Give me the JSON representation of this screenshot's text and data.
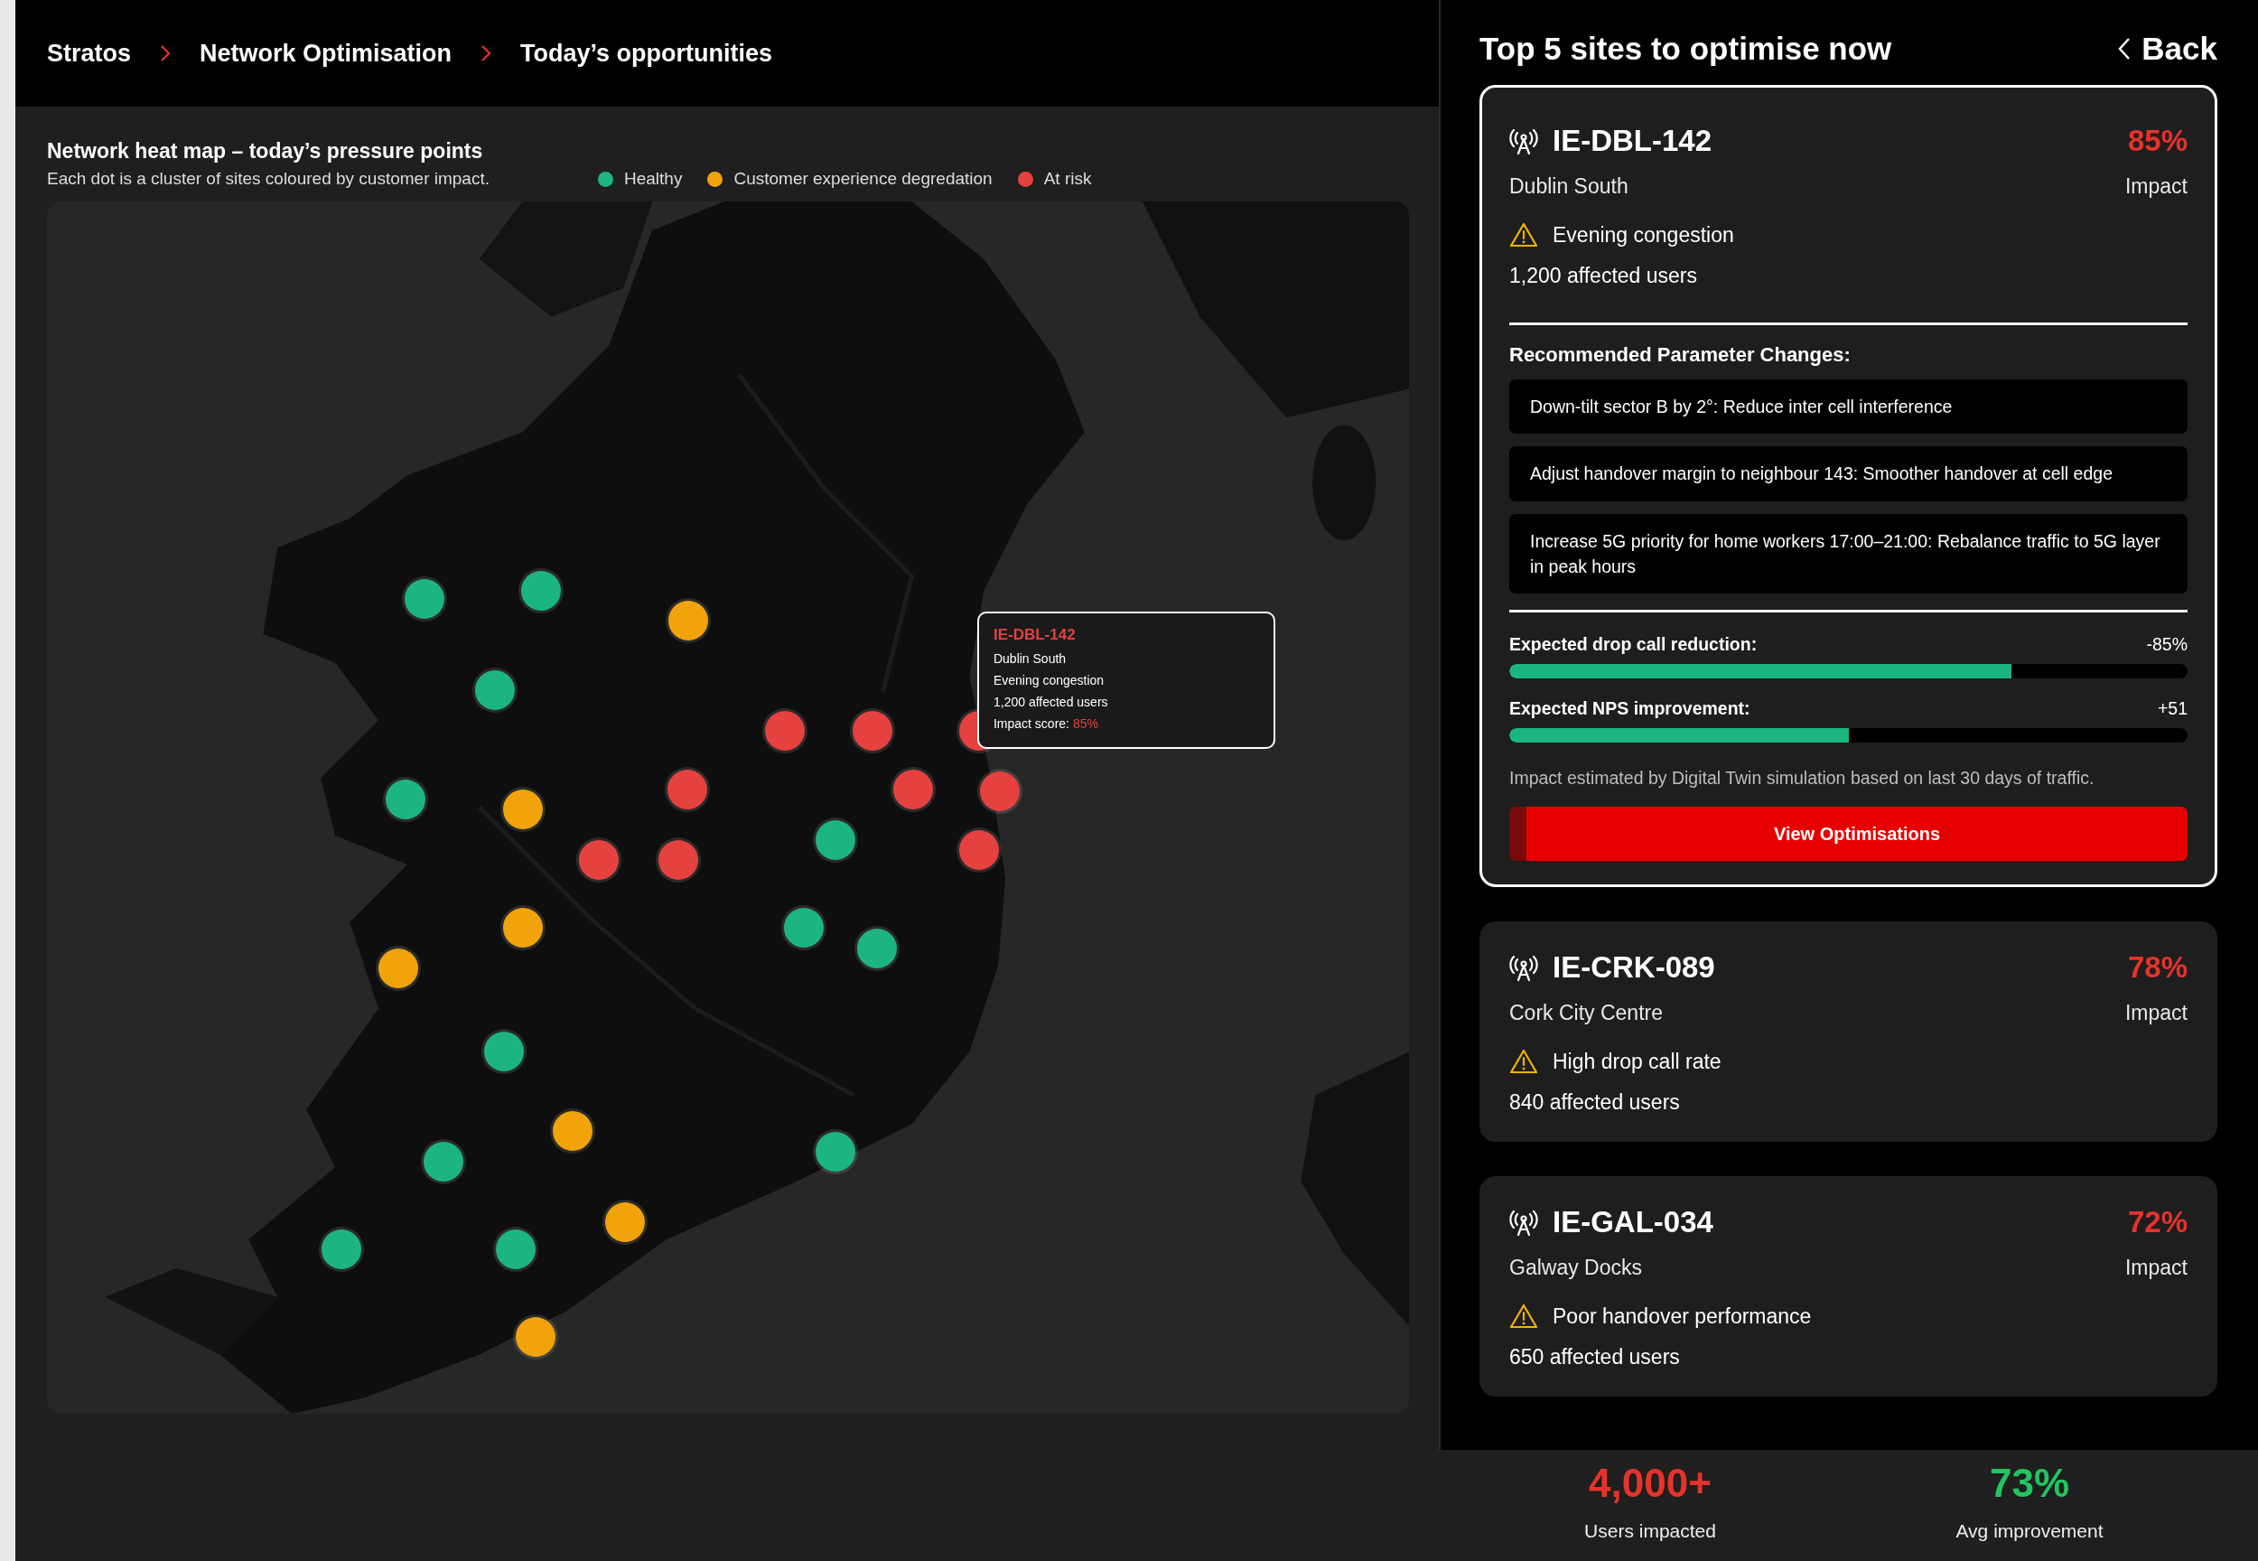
{
  "breadcrumb": [
    {
      "label": "Stratos"
    },
    {
      "label": "Network Optimisation"
    },
    {
      "label": "Today’s opportunities"
    }
  ],
  "heat_map": {
    "title": "Network heat map – today’s pressure points",
    "subtitle": "Each dot is a cluster of sites coloured by customer impact.",
    "legend": [
      {
        "label": "Healthy",
        "color": "#1db57f"
      },
      {
        "label": "Customer experience degredation",
        "color": "#f0a30a"
      },
      {
        "label": "At risk",
        "color": "#e5413f"
      }
    ],
    "markers": [
      {
        "color": "#1db57f"
      },
      {
        "color": "#1db57f"
      },
      {
        "color": "#1db57f"
      },
      {
        "color": "#1db57f"
      },
      {
        "color": "#1db57f"
      },
      {
        "color": "#1db57f"
      },
      {
        "color": "#1db57f"
      },
      {
        "color": "#1db57f"
      },
      {
        "color": "#1db57f"
      },
      {
        "color": "#1db57f"
      },
      {
        "color": "#1db57f"
      },
      {
        "color": "#1db57f"
      },
      {
        "color": "#f0a30a"
      },
      {
        "color": "#f0a30a"
      },
      {
        "color": "#f0a30a"
      },
      {
        "color": "#f0a30a"
      },
      {
        "color": "#f0a30a"
      },
      {
        "color": "#f0a30a"
      },
      {
        "color": "#f0a30a"
      },
      {
        "color": "#e5413f"
      },
      {
        "color": "#e5413f"
      },
      {
        "color": "#e5413f"
      },
      {
        "color": "#e5413f"
      },
      {
        "color": "#e5413f"
      },
      {
        "color": "#e5413f"
      },
      {
        "color": "#e5413f"
      },
      {
        "color": "#e5413f"
      },
      {
        "color": "#e5413f"
      }
    ],
    "tooltip": {
      "site_id": "IE-DBL-142",
      "location": "Dublin South",
      "issue": "Evening congestion",
      "users": "1,200 affected users",
      "impact_label": "Impact score:",
      "impact_value": "85%"
    }
  },
  "panel": {
    "title": "Top 5 sites to optimise now",
    "back": "Back",
    "sites": [
      {
        "selected": true,
        "site_id": "IE-DBL-142",
        "impact": "85%",
        "location": "Dublin South",
        "impact_label": "Impact",
        "issue": "Evening congestion",
        "users": "1,200 affected users",
        "recommendations_title": "Recommended Parameter Changes:",
        "recommendations": [
          "Down-tilt sector B by 2°: Reduce inter cell interference",
          "Adjust handover margin to neighbour 143: Smoother handover at cell edge",
          "Increase 5G priority for home workers 17:00–21:00: Rebalance traffic to 5G layer in peak hours"
        ],
        "metrics": [
          {
            "label": "Expected drop call reduction:",
            "reading": "-85%",
            "level": 0.74
          },
          {
            "label": "Expected NPS improvement:",
            "reading": "+51",
            "level": 0.5
          }
        ],
        "note": "Impact estimated by Digital Twin simulation based on last 30 days of traffic.",
        "button": "View Optimisations"
      },
      {
        "selected": false,
        "site_id": "IE-CRK-089",
        "impact": "78%",
        "location": "Cork City Centre",
        "impact_label": "Impact",
        "issue": "High drop call rate",
        "users": "840 affected users"
      },
      {
        "selected": false,
        "site_id": "IE-GAL-034",
        "impact": "72%",
        "location": "Galway Docks",
        "impact_label": "Impact",
        "issue": "Poor handover performance",
        "users": "650 affected users"
      }
    ]
  },
  "stats": [
    {
      "value": "4,000+",
      "label": "Users impacted",
      "color": "#e5332a"
    },
    {
      "value": "73%",
      "label": "Avg improvement",
      "color": "#22c55e"
    }
  ]
}
